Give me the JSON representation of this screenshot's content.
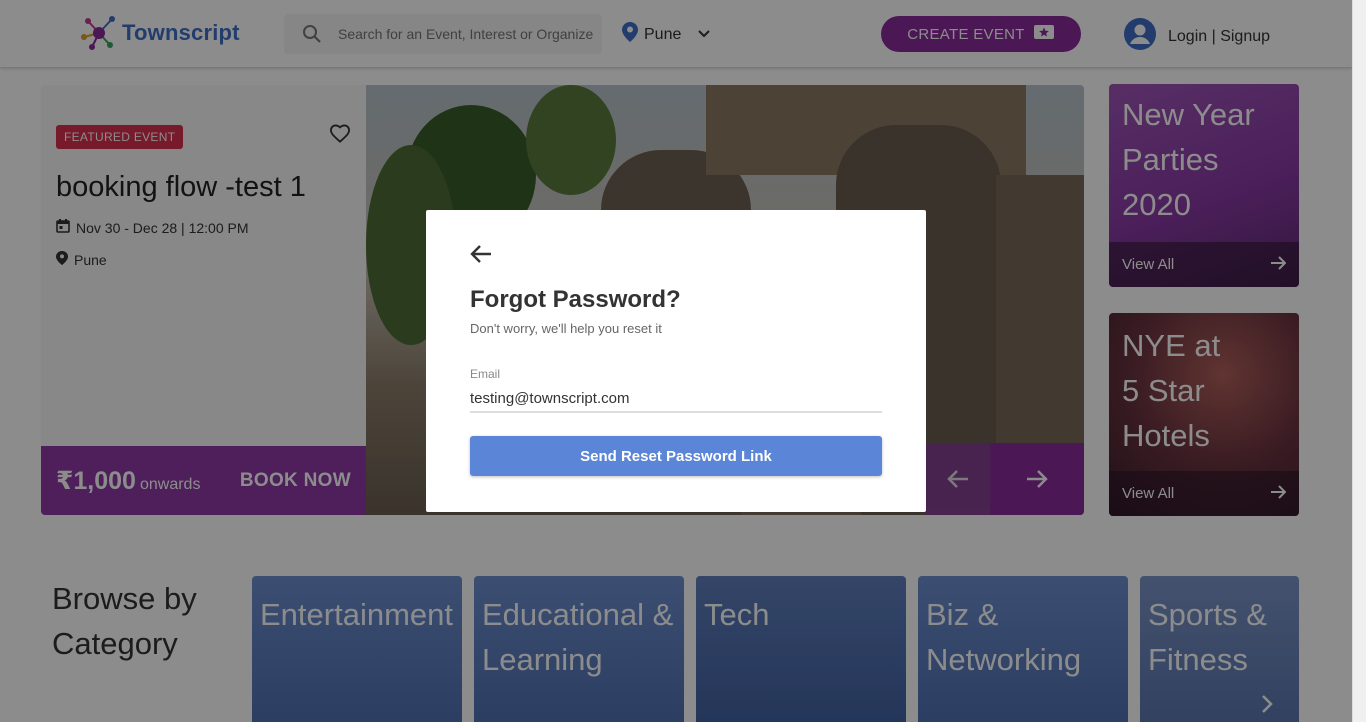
{
  "header": {
    "logo_text": "Townscript",
    "search_placeholder": "Search for an Event, Interest or Organizer",
    "city": "Pune",
    "create_event_label": "CREATE EVENT",
    "login_label": "Login | Signup"
  },
  "featured": {
    "badge": "FEATURED EVENT",
    "title": "booking flow -test 1",
    "date": "Nov 30 - Dec 28 | 12:00 PM",
    "location": "Pune",
    "price": "₹1,000",
    "price_suffix": "onwards",
    "book_label": "BOOK NOW"
  },
  "side_cards": [
    {
      "title_lines": [
        "New Year",
        "Parties",
        "2020"
      ],
      "link": "View All"
    },
    {
      "title_lines": [
        "NYE at",
        "5 Star",
        "Hotels"
      ],
      "link": "View All"
    }
  ],
  "browse": {
    "heading_lines": [
      "Browse by",
      "Category"
    ],
    "categories": [
      {
        "label_lines": [
          "Entertainment"
        ]
      },
      {
        "label_lines": [
          "Educational &",
          "Learning"
        ]
      },
      {
        "label_lines": [
          "Tech"
        ]
      },
      {
        "label_lines": [
          "Biz &",
          "Networking"
        ]
      },
      {
        "label_lines": [
          "Sports &",
          "Fitness"
        ]
      }
    ]
  },
  "modal": {
    "title": "Forgot Password?",
    "subtitle": "Don't worry, we'll help you reset it",
    "email_label": "Email",
    "email_value": "testing@townscript.com",
    "submit_label": "Send Reset Password Link"
  },
  "colors": {
    "brand_purple": "#8a2a9c",
    "badge_red": "#d9304f",
    "button_blue": "#5b85d6",
    "logo_blue": "#3f6fc7"
  }
}
